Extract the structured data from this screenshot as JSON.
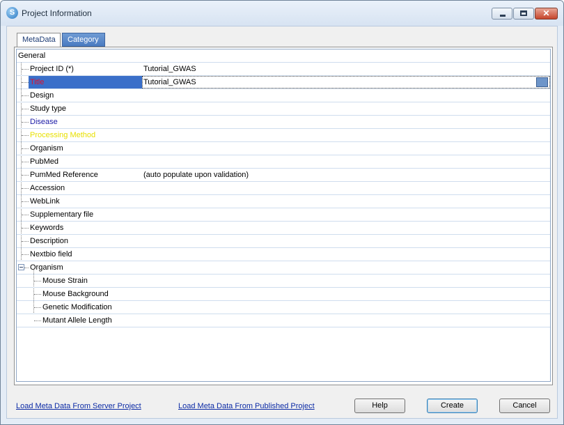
{
  "window": {
    "title": "Project Information",
    "close_glyph": "✕"
  },
  "tabs": [
    {
      "label": "MetaData",
      "active": true
    },
    {
      "label": "Category",
      "active": false
    }
  ],
  "tree": {
    "root_label": "General",
    "rows": [
      {
        "label": "Project ID (*)",
        "value": "Tutorial_GWAS",
        "color": "#000000"
      },
      {
        "label": "Title",
        "value": "Tutorial_GWAS",
        "color": "#e0102a",
        "selected": true
      },
      {
        "label": "Design",
        "value": "",
        "color": "#000000"
      },
      {
        "label": "Study type",
        "value": "",
        "color": "#000000"
      },
      {
        "label": "Disease",
        "value": "",
        "color": "#1a1aa6"
      },
      {
        "label": "Processing Method",
        "value": "",
        "color": "#e8e000"
      },
      {
        "label": "Organism",
        "value": "",
        "color": "#000000"
      },
      {
        "label": "PubMed",
        "value": "",
        "color": "#000000"
      },
      {
        "label": "PumMed Reference",
        "value": "(auto populate upon validation)",
        "color": "#000000"
      },
      {
        "label": "Accession",
        "value": "",
        "color": "#000000"
      },
      {
        "label": "WebLink",
        "value": "",
        "color": "#000000"
      },
      {
        "label": "Supplementary file",
        "value": "",
        "color": "#000000"
      },
      {
        "label": "Keywords",
        "value": "",
        "color": "#000000"
      },
      {
        "label": "Description",
        "value": "",
        "color": "#000000"
      },
      {
        "label": "Nextbio field",
        "value": "",
        "color": "#000000"
      }
    ],
    "group": {
      "label": "Organism",
      "expanded": true,
      "children": [
        {
          "label": "Mouse Strain"
        },
        {
          "label": "Mouse Background"
        },
        {
          "label": "Genetic Modification"
        },
        {
          "label": "Mutant Allele Length"
        }
      ]
    }
  },
  "footer": {
    "link_server": "Load Meta Data From Server Project",
    "link_published": "Load Meta Data From Published Project",
    "help_label": "Help",
    "create_label": "Create",
    "cancel_label": "Cancel"
  }
}
